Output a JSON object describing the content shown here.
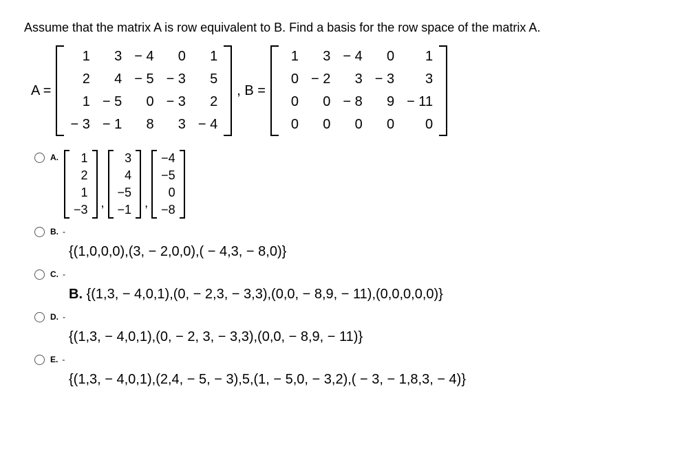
{
  "question": "Assume that the matrix A is row equivalent to B. Find a basis for the row space of the matrix A.",
  "labelA": "A =",
  "labelB": ", B =",
  "matrixA": [
    [
      "1",
      "3",
      "− 4",
      "0",
      "1"
    ],
    [
      "2",
      "4",
      "− 5",
      "− 3",
      "5"
    ],
    [
      "1",
      "− 5",
      "0",
      "− 3",
      "2"
    ],
    [
      "− 3",
      "− 1",
      "8",
      "3",
      "− 4"
    ]
  ],
  "matrixB": [
    [
      "1",
      "3",
      "− 4",
      "0",
      "1"
    ],
    [
      "0",
      "− 2",
      "3",
      "− 3",
      "3"
    ],
    [
      "0",
      "0",
      "− 8",
      "9",
      "− 11"
    ],
    [
      "0",
      "0",
      "0",
      "0",
      "0"
    ]
  ],
  "optionA_cols": [
    [
      "1",
      "2",
      "1",
      "−3"
    ],
    [
      "3",
      "4",
      "−5",
      "−1"
    ],
    [
      "−4",
      "−5",
      "0",
      "−8"
    ]
  ],
  "optionB_text": "{(1,0,0,0),(3, − 2,0,0),( − 4,3, − 8,0)}",
  "optionC_prefix": "B.  ",
  "optionC_text": "{(1,3, − 4,0,1),(0, − 2,3, − 3,3),(0,0, − 8,9, − 11),(0,0,0,0,0)}",
  "optionD_text": "{(1,3, − 4,0,1),(0, − 2, 3, − 3,3),(0,0, − 8,9, − 11)}",
  "optionE_text": "{(1,3, − 4,0,1),(2,4, − 5, − 3),5,(1, − 5,0, − 3,2),( − 3, − 1,8,3, − 4)}",
  "letters": {
    "a": "A.",
    "b": "B.",
    "c": "C.",
    "d": "D.",
    "e": "E."
  },
  "dash": "-"
}
